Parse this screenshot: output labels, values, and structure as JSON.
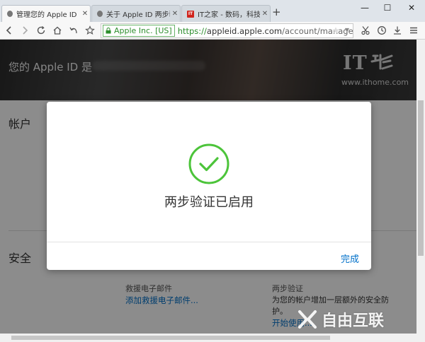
{
  "tabs": [
    {
      "label": "管理您的 Apple ID",
      "favicon": "apple-icon",
      "active": true
    },
    {
      "label": "关于 Apple ID 两步验证",
      "favicon": "apple-icon",
      "active": false
    },
    {
      "label": "IT之家 - 数码，科技，生活",
      "favicon": "ithome-icon",
      "active": false
    }
  ],
  "window": {
    "new_tab": "+",
    "minimize": "—",
    "maximize": "☐",
    "close": "✕"
  },
  "address_bar": {
    "security_label": "Apple Inc. [US]",
    "url_scheme": "https://",
    "url_host": "appleid.apple.com",
    "url_path": "/account/manage"
  },
  "page": {
    "hero_title": "您的 Apple ID 是",
    "watermark_logo": "IT之家",
    "watermark_logo_short": "IT",
    "watermark_url": "www.ithome.com",
    "account_label": "帐户",
    "security_label": "安全",
    "rescue_email_label": "救援电子邮件",
    "rescue_email_link": "添加救援电子邮件...",
    "two_step_label": "两步验证",
    "two_step_desc_1": "为您的帐户增加一层额外的安全防",
    "two_step_desc_2": "护。",
    "two_step_link": "开始使用..."
  },
  "modal": {
    "title": "两步验证已启用",
    "done_button": "完成"
  },
  "bottom_watermark": "自由互联",
  "colors": {
    "accent": "#0070c9",
    "success": "#4cc43a",
    "ev_green": "#2c8e2c"
  }
}
